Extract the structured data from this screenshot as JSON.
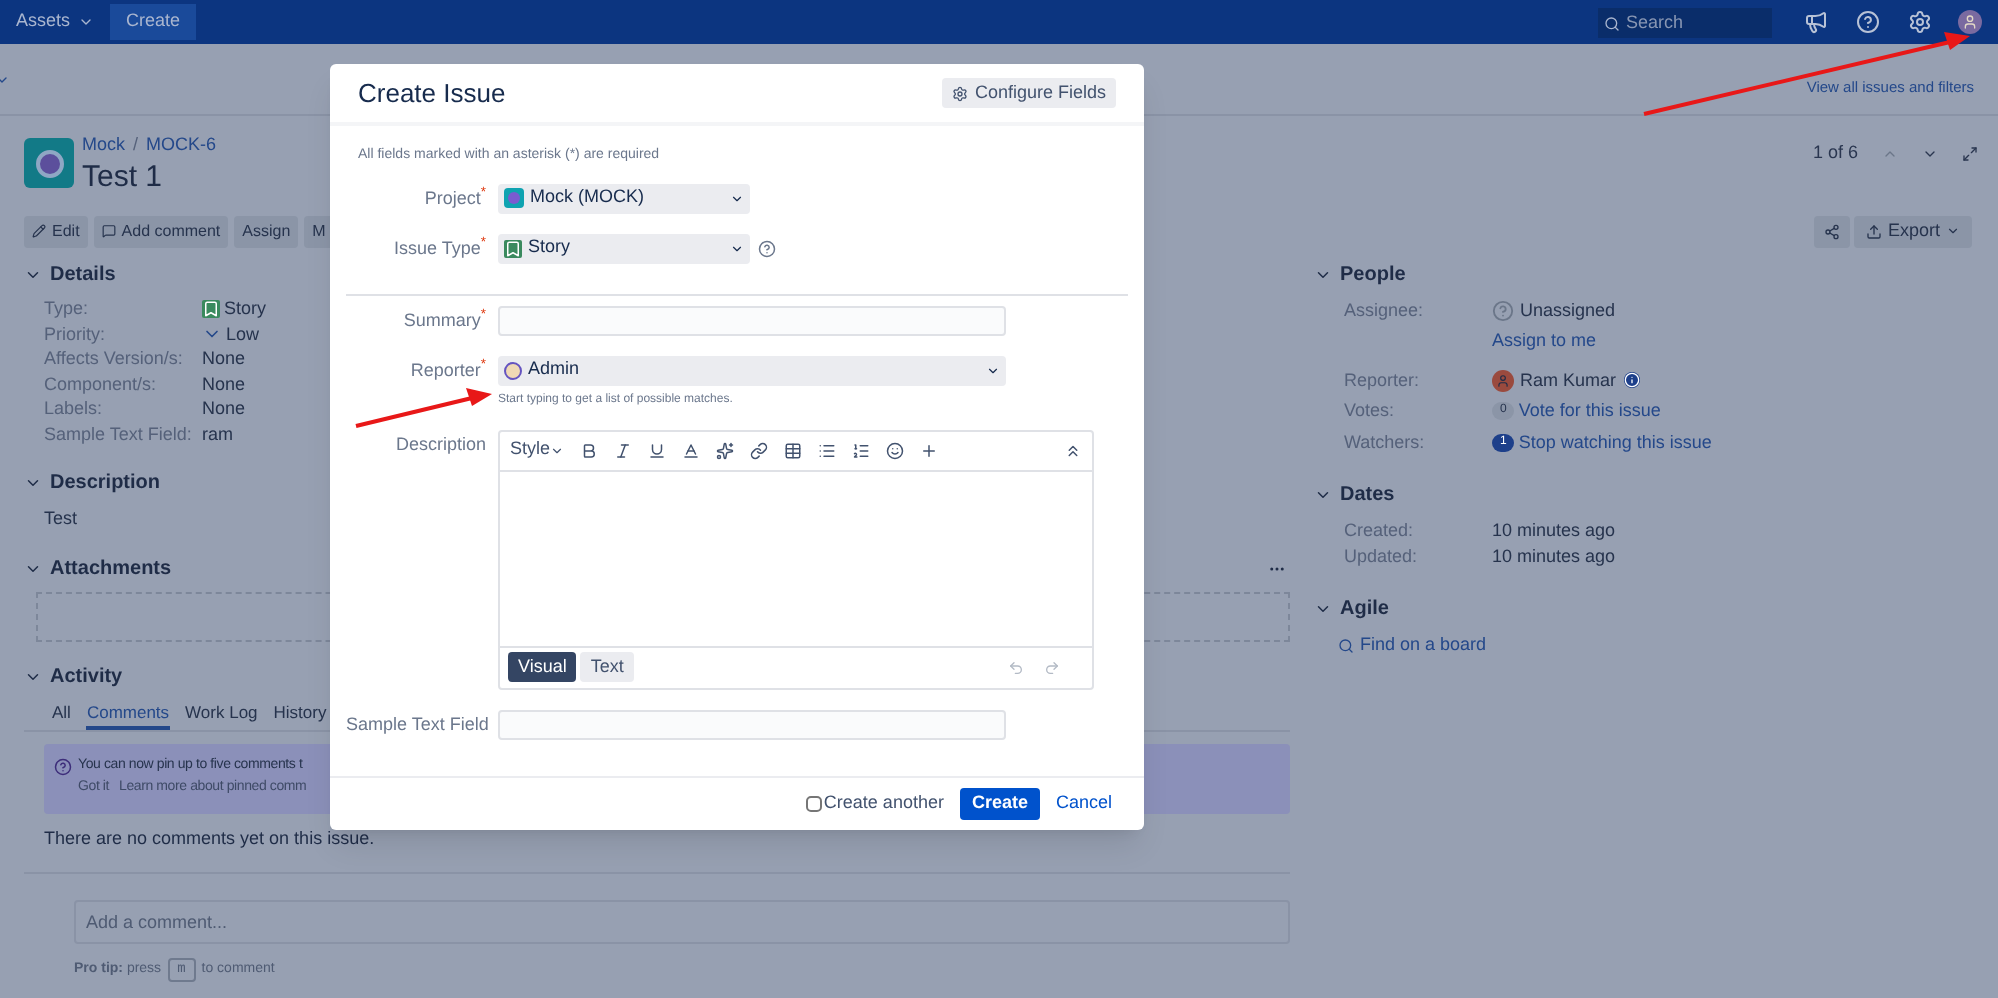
{
  "top_nav": {
    "items": [
      {
        "label": "Assets",
        "kind": "dropdown",
        "selected": false
      },
      {
        "label": "Create",
        "kind": "button",
        "selected": true
      }
    ],
    "search": {
      "placeholder": "Search"
    }
  },
  "view_all_link": "View all issues and filters",
  "issue": {
    "project": "Mock",
    "separator": "/",
    "key": "MOCK-6",
    "title": "Test 1",
    "pager": "1 of 6"
  },
  "actions": [
    {
      "label": "Edit",
      "kind": "edit"
    },
    {
      "label": "Add comment",
      "kind": "comment"
    },
    {
      "label": "Assign",
      "kind": "plain"
    },
    {
      "label": "M",
      "kind": "plain"
    }
  ],
  "export_button": "Export",
  "details": {
    "title": "Details",
    "fields": [
      {
        "label": "Type:",
        "value": "Story",
        "kind": "story"
      },
      {
        "label": "Priority:",
        "value": "Low",
        "kind": "priority"
      },
      {
        "label": "Affects Version/s:",
        "value": "None",
        "kind": "plain"
      },
      {
        "label": "Component/s:",
        "value": "None",
        "kind": "plain"
      },
      {
        "label": "Labels:",
        "value": "None",
        "kind": "plain"
      },
      {
        "label": "Sample Text Field:",
        "value": "ram",
        "kind": "plain"
      }
    ]
  },
  "description": {
    "title": "Description",
    "text": "Test"
  },
  "attachments": {
    "title": "Attachments"
  },
  "activity": {
    "title": "Activity",
    "tabs": [
      {
        "label": "All",
        "selected": false
      },
      {
        "label": "Comments",
        "selected": true
      },
      {
        "label": "Work Log",
        "selected": false
      },
      {
        "label": "History",
        "selected": false
      }
    ],
    "notice": {
      "text": "You can now pin up to five comments t",
      "dismiss": "Got it",
      "learn_more": "Learn more about pinned comm"
    },
    "empty": "There are no comments yet on this issue.",
    "comment_placeholder": "Add a comment...",
    "pro_tip": {
      "lead": "**Pro tip:** press",
      "key": "m",
      "tail": "to comment"
    }
  },
  "people": {
    "title": "People",
    "assignee": {
      "label": "Assignee:",
      "value": "Unassigned",
      "action": "Assign to me"
    },
    "reporter": {
      "label": "Reporter:",
      "value": "Ram Kumar"
    },
    "votes": {
      "label": "Votes:",
      "count": "0",
      "action": "Vote for this issue"
    },
    "watchers": {
      "label": "Watchers:",
      "count": "1",
      "action": "Stop watching this issue"
    }
  },
  "dates": {
    "title": "Dates",
    "rows": [
      {
        "label": "Created:",
        "value": "10 minutes ago"
      },
      {
        "label": "Updated:",
        "value": "10 minutes ago"
      }
    ]
  },
  "agile": {
    "title": "Agile",
    "link": "Find on a board"
  },
  "modal": {
    "title": "Create Issue",
    "configure_button": "Configure Fields",
    "required_note": "All fields marked with an asterisk (*) are required",
    "fields": [
      {
        "label": "Project$^{*}$",
        "kind": "select",
        "value": "Mock (MOCK)",
        "help": false
      },
      {
        "label": "Issue Type$^{*}$",
        "kind": "select",
        "value": "Story",
        "help": true
      },
      {
        "kind": "divider"
      },
      {
        "label": "Summary$^{*}$",
        "kind": "text"
      },
      {
        "label": "Reporter$^{*}$",
        "kind": "user_select",
        "value": "Admin",
        "hint": "Start typing to get a list of possible matches."
      },
      {
        "label": "Description",
        "kind": "editor"
      },
      {
        "label": "Sample Text Field",
        "kind": "text"
      }
    ],
    "editor": {
      "style_menu": "Style",
      "modes": [
        {
          "label": "Visual",
          "selected": true
        },
        {
          "label": "Text",
          "selected": false
        }
      ]
    },
    "create_another": {
      "label": "Create another",
      "checked": false
    },
    "submit": "Create",
    "cancel": "Cancel"
  }
}
